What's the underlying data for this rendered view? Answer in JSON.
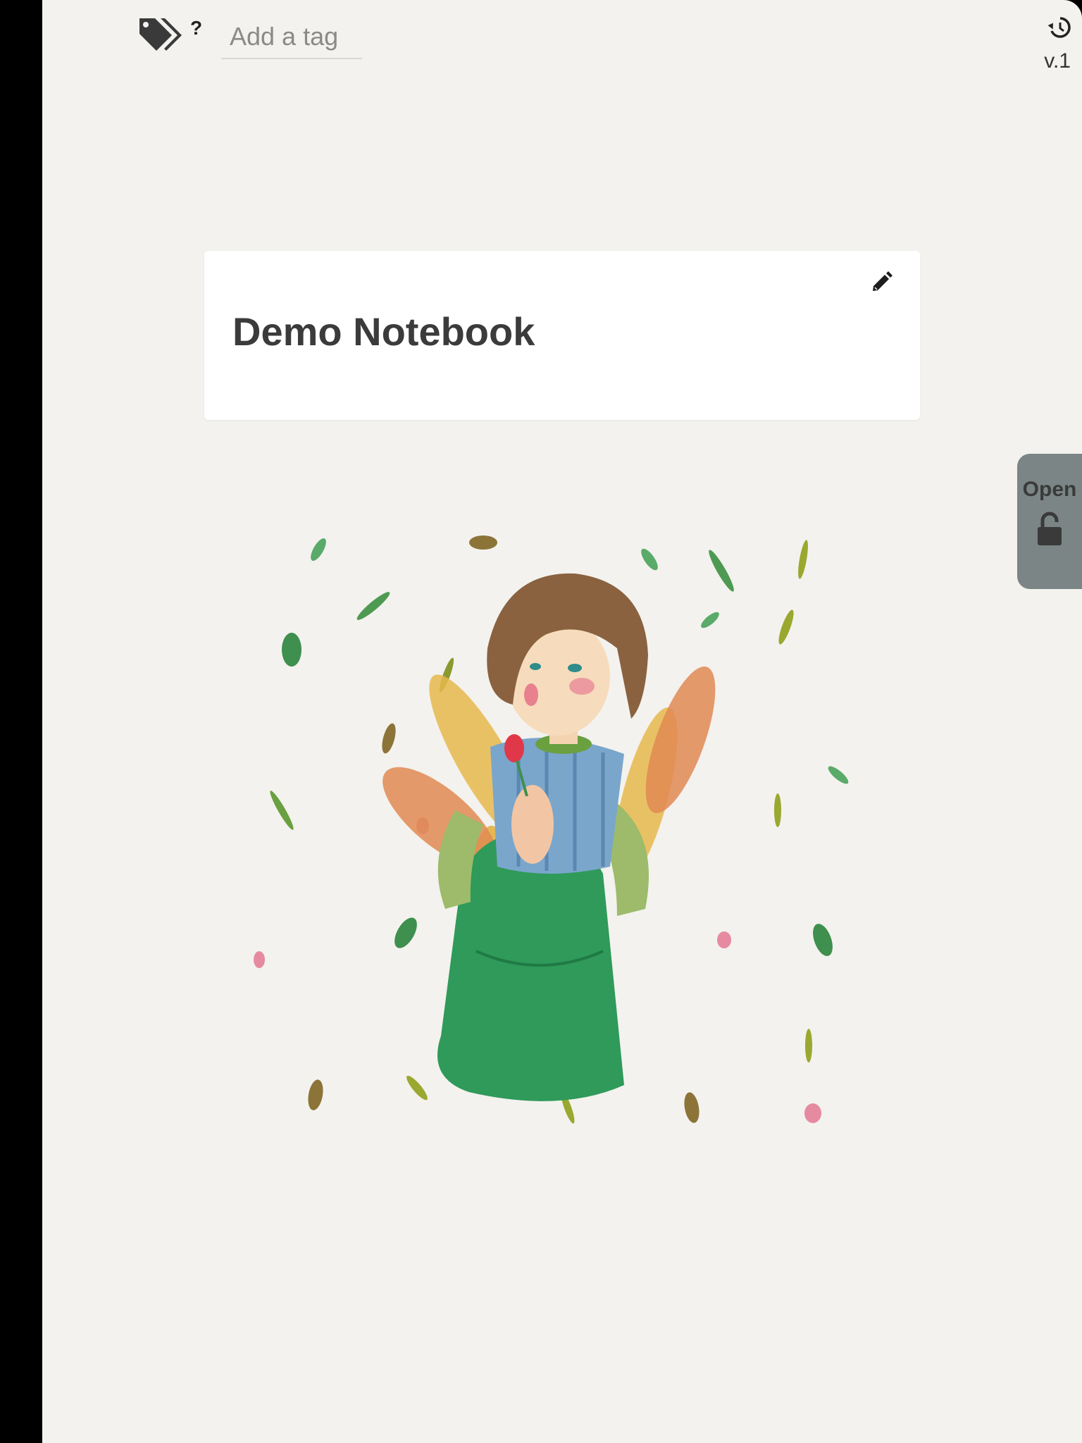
{
  "tags": {
    "help_label": "?",
    "input_placeholder": "Add a tag",
    "input_value": ""
  },
  "history": {
    "version_label": "v.1"
  },
  "notebook": {
    "title": "Demo Notebook"
  },
  "side_tab": {
    "label": "Open"
  },
  "icons": {
    "tags": "tags-icon",
    "history": "history-icon",
    "edit": "pencil-icon",
    "lock": "unlocked-lock-icon"
  },
  "colors": {
    "page_background": "#f3f2ee",
    "card_background": "#ffffff",
    "side_tab": "#7b8585",
    "title_text": "#3b3b3b"
  }
}
